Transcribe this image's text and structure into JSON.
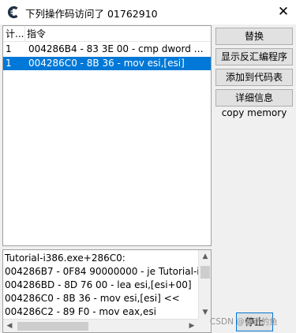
{
  "window": {
    "title": "下列操作码访问了 01762910",
    "app_icon": "cheat-engine-icon",
    "close_symbol": "✕"
  },
  "list": {
    "columns": [
      "计...",
      "指令"
    ],
    "rows": [
      {
        "count": "1",
        "instruction": "004286B4 - 83 3E 00 - cmp dword pt...",
        "selected": false
      },
      {
        "count": "1",
        "instruction": "004286C0 - 8B 36  - mov esi,[esi]",
        "selected": true
      }
    ]
  },
  "buttons": {
    "replace": "替换",
    "show_disassembler": "显示反汇编程序",
    "add_to_codelist": "添加到代码表",
    "more_info": "详细信息",
    "copy_memory": "copy memory",
    "stop": "停止"
  },
  "disassembly": {
    "lines": [
      "Tutorial-i386.exe+286C0:",
      "004286B7 - 0F84 90000000 - je Tutorial-i",
      "004286BD - 8D 76 00  - lea esi,[esi+00]",
      "004286C0 - 8B 36  - mov esi,[esi] <<",
      "004286C2 - 89 F0  - mov eax,esi"
    ]
  },
  "watermark": "CSDN @猎奇的鱼",
  "colors": {
    "selection": "#0078d7",
    "button_face": "#e1e1e1",
    "window_bg": "#f0f0f0"
  }
}
